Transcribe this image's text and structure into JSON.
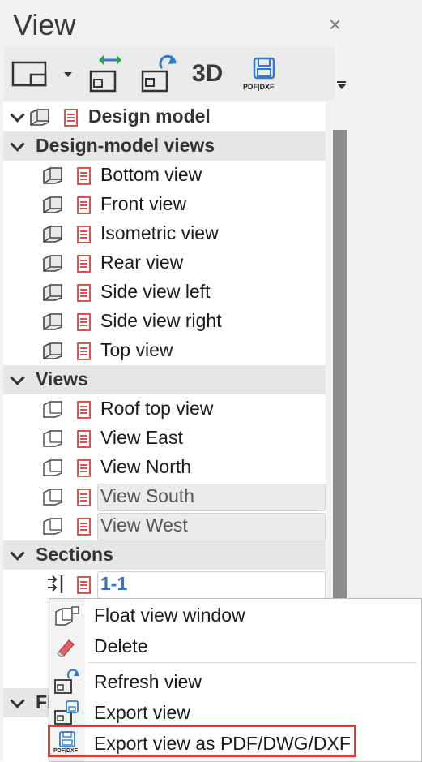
{
  "panel": {
    "title": "View",
    "close_glyph": "×"
  },
  "toolbar": {
    "three_d_label": "3D",
    "pdf_dxf_label": "PDF|DXF"
  },
  "tree": {
    "design_model": "Design model",
    "design_model_views_header": "Design-model views",
    "design_model_views": [
      "Bottom view",
      "Front view",
      "Isometric view",
      "Rear view",
      "Side view left",
      "Side view right",
      "Top view"
    ],
    "views_header": "Views",
    "views": [
      "Roof top view",
      "View East",
      "View North",
      "View South",
      "View West"
    ],
    "sections_header": "Sections",
    "sections": [
      "1-1"
    ],
    "bottom_header_partial": "Fl"
  },
  "context_menu": {
    "items": [
      "Float view window",
      "Delete",
      "Refresh view",
      "Export view",
      "Export view as PDF/DWG/DXF"
    ],
    "pdf_icon_label": "PDF|DXF"
  },
  "colors": {
    "doc_icon": "#d9534f",
    "selection_blue": "#3a6fc9",
    "highlight_red": "#e53935"
  }
}
